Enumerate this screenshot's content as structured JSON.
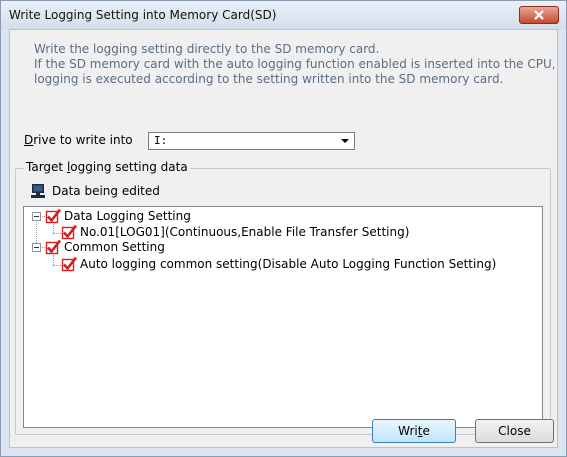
{
  "window": {
    "title": "Write Logging Setting into Memory Card(SD)"
  },
  "description": {
    "line1": "Write the logging setting directly to the SD memory card.",
    "line2": "If the SD memory card with the auto logging function enabled is inserted into the CPU,",
    "line3": "logging is executed according to the setting written into the SD memory card."
  },
  "drive": {
    "label_mnemonic": "D",
    "label_rest": "rive to write into",
    "selected": "I:"
  },
  "target": {
    "group_label_pre": "Target ",
    "group_label_mnemonic": "l",
    "group_label_post": "ogging setting data",
    "source_label": "Data being edited"
  },
  "tree": {
    "items": [
      {
        "label": "Data Logging Setting",
        "checked": true
      },
      {
        "label": "No.01[LOG01](Continuous,Enable File Transfer Setting)",
        "checked": true
      },
      {
        "label": "Common Setting",
        "checked": true
      },
      {
        "label": "Auto logging common setting(Disable Auto Logging Function Setting)",
        "checked": true
      }
    ]
  },
  "buttons": {
    "write_pre": "Wri",
    "write_mnemonic": "t",
    "write_post": "e",
    "close": "Close"
  },
  "colors": {
    "check_red": "#d42020",
    "desc_text": "#5a6d86",
    "close_button": "#c7492f"
  }
}
